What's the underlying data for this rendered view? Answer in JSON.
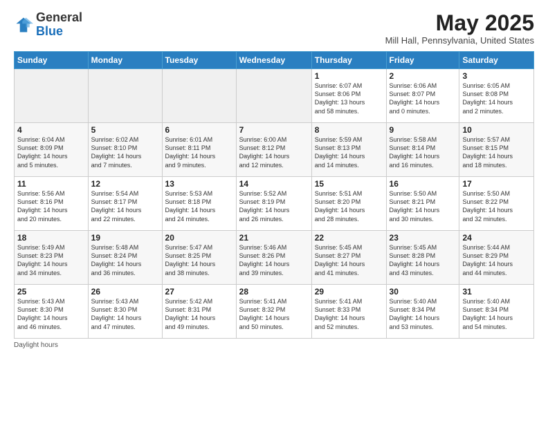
{
  "header": {
    "logo_general": "General",
    "logo_blue": "Blue",
    "month_title": "May 2025",
    "location": "Mill Hall, Pennsylvania, United States"
  },
  "weekdays": [
    "Sunday",
    "Monday",
    "Tuesday",
    "Wednesday",
    "Thursday",
    "Friday",
    "Saturday"
  ],
  "weeks": [
    [
      {
        "day": "",
        "info": ""
      },
      {
        "day": "",
        "info": ""
      },
      {
        "day": "",
        "info": ""
      },
      {
        "day": "",
        "info": ""
      },
      {
        "day": "1",
        "info": "Sunrise: 6:07 AM\nSunset: 8:06 PM\nDaylight: 13 hours\nand 58 minutes."
      },
      {
        "day": "2",
        "info": "Sunrise: 6:06 AM\nSunset: 8:07 PM\nDaylight: 14 hours\nand 0 minutes."
      },
      {
        "day": "3",
        "info": "Sunrise: 6:05 AM\nSunset: 8:08 PM\nDaylight: 14 hours\nand 2 minutes."
      }
    ],
    [
      {
        "day": "4",
        "info": "Sunrise: 6:04 AM\nSunset: 8:09 PM\nDaylight: 14 hours\nand 5 minutes."
      },
      {
        "day": "5",
        "info": "Sunrise: 6:02 AM\nSunset: 8:10 PM\nDaylight: 14 hours\nand 7 minutes."
      },
      {
        "day": "6",
        "info": "Sunrise: 6:01 AM\nSunset: 8:11 PM\nDaylight: 14 hours\nand 9 minutes."
      },
      {
        "day": "7",
        "info": "Sunrise: 6:00 AM\nSunset: 8:12 PM\nDaylight: 14 hours\nand 12 minutes."
      },
      {
        "day": "8",
        "info": "Sunrise: 5:59 AM\nSunset: 8:13 PM\nDaylight: 14 hours\nand 14 minutes."
      },
      {
        "day": "9",
        "info": "Sunrise: 5:58 AM\nSunset: 8:14 PM\nDaylight: 14 hours\nand 16 minutes."
      },
      {
        "day": "10",
        "info": "Sunrise: 5:57 AM\nSunset: 8:15 PM\nDaylight: 14 hours\nand 18 minutes."
      }
    ],
    [
      {
        "day": "11",
        "info": "Sunrise: 5:56 AM\nSunset: 8:16 PM\nDaylight: 14 hours\nand 20 minutes."
      },
      {
        "day": "12",
        "info": "Sunrise: 5:54 AM\nSunset: 8:17 PM\nDaylight: 14 hours\nand 22 minutes."
      },
      {
        "day": "13",
        "info": "Sunrise: 5:53 AM\nSunset: 8:18 PM\nDaylight: 14 hours\nand 24 minutes."
      },
      {
        "day": "14",
        "info": "Sunrise: 5:52 AM\nSunset: 8:19 PM\nDaylight: 14 hours\nand 26 minutes."
      },
      {
        "day": "15",
        "info": "Sunrise: 5:51 AM\nSunset: 8:20 PM\nDaylight: 14 hours\nand 28 minutes."
      },
      {
        "day": "16",
        "info": "Sunrise: 5:50 AM\nSunset: 8:21 PM\nDaylight: 14 hours\nand 30 minutes."
      },
      {
        "day": "17",
        "info": "Sunrise: 5:50 AM\nSunset: 8:22 PM\nDaylight: 14 hours\nand 32 minutes."
      }
    ],
    [
      {
        "day": "18",
        "info": "Sunrise: 5:49 AM\nSunset: 8:23 PM\nDaylight: 14 hours\nand 34 minutes."
      },
      {
        "day": "19",
        "info": "Sunrise: 5:48 AM\nSunset: 8:24 PM\nDaylight: 14 hours\nand 36 minutes."
      },
      {
        "day": "20",
        "info": "Sunrise: 5:47 AM\nSunset: 8:25 PM\nDaylight: 14 hours\nand 38 minutes."
      },
      {
        "day": "21",
        "info": "Sunrise: 5:46 AM\nSunset: 8:26 PM\nDaylight: 14 hours\nand 39 minutes."
      },
      {
        "day": "22",
        "info": "Sunrise: 5:45 AM\nSunset: 8:27 PM\nDaylight: 14 hours\nand 41 minutes."
      },
      {
        "day": "23",
        "info": "Sunrise: 5:45 AM\nSunset: 8:28 PM\nDaylight: 14 hours\nand 43 minutes."
      },
      {
        "day": "24",
        "info": "Sunrise: 5:44 AM\nSunset: 8:29 PM\nDaylight: 14 hours\nand 44 minutes."
      }
    ],
    [
      {
        "day": "25",
        "info": "Sunrise: 5:43 AM\nSunset: 8:30 PM\nDaylight: 14 hours\nand 46 minutes."
      },
      {
        "day": "26",
        "info": "Sunrise: 5:43 AM\nSunset: 8:30 PM\nDaylight: 14 hours\nand 47 minutes."
      },
      {
        "day": "27",
        "info": "Sunrise: 5:42 AM\nSunset: 8:31 PM\nDaylight: 14 hours\nand 49 minutes."
      },
      {
        "day": "28",
        "info": "Sunrise: 5:41 AM\nSunset: 8:32 PM\nDaylight: 14 hours\nand 50 minutes."
      },
      {
        "day": "29",
        "info": "Sunrise: 5:41 AM\nSunset: 8:33 PM\nDaylight: 14 hours\nand 52 minutes."
      },
      {
        "day": "30",
        "info": "Sunrise: 5:40 AM\nSunset: 8:34 PM\nDaylight: 14 hours\nand 53 minutes."
      },
      {
        "day": "31",
        "info": "Sunrise: 5:40 AM\nSunset: 8:34 PM\nDaylight: 14 hours\nand 54 minutes."
      }
    ]
  ],
  "footer": {
    "note": "Daylight hours"
  }
}
